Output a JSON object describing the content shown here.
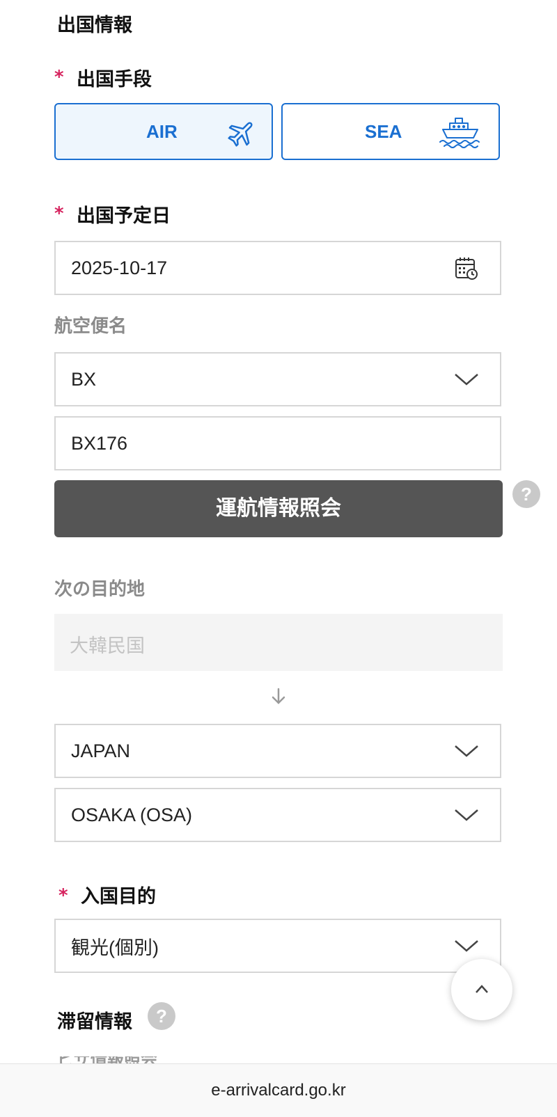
{
  "exit_section": {
    "title": "出国情報",
    "exit_mode": {
      "required_mark": "*",
      "label": "出国手段",
      "options": [
        {
          "label": "AIR",
          "icon": "airplane-icon",
          "selected": true
        },
        {
          "label": "SEA",
          "icon": "ship-icon",
          "selected": false
        }
      ]
    },
    "departure_date": {
      "required_mark": "*",
      "label": "出国予定日",
      "value": "2025-10-17",
      "icon": "calendar-icon"
    },
    "flight": {
      "label": "航空便名",
      "airline_value": "BX",
      "flight_number_value": "BX176",
      "inquiry_button_label": "運航情報照会",
      "help_symbol": "?"
    },
    "next_destination": {
      "label": "次の目的地",
      "origin_value": "大韓民国",
      "country_value": "JAPAN",
      "city_value": "OSAKA (OSA)"
    },
    "entry_purpose": {
      "required_mark": "*",
      "label": "入国目的",
      "value": "観光(個別)"
    }
  },
  "stay_section": {
    "title": "滞留情報",
    "help_symbol": "?",
    "next_label_partial": "ビザ情報照会"
  },
  "footer": {
    "url": "e-arrivalcard.go.kr"
  },
  "colors": {
    "accent": "#1a6fd1",
    "required": "#d6245f",
    "button_dark": "#555555"
  }
}
